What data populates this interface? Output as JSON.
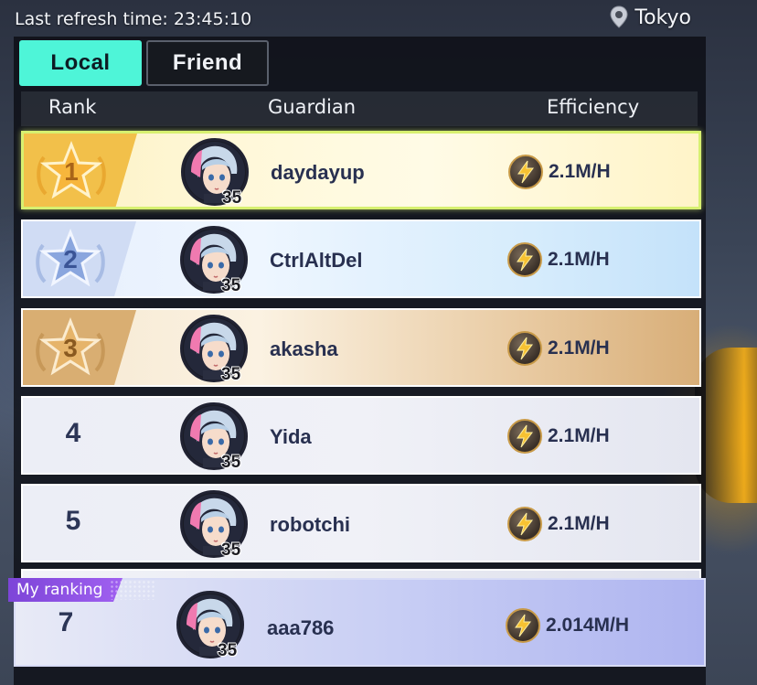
{
  "header": {
    "refresh_label": "Last refresh time: 23:45:10",
    "location": "Tokyo",
    "location_icon": "pin-icon"
  },
  "tabs": [
    {
      "label": "Local",
      "active": true
    },
    {
      "label": "Friend",
      "active": false
    }
  ],
  "columns": {
    "rank": "Rank",
    "guardian": "Guardian",
    "efficiency": "Efficiency"
  },
  "rows": [
    {
      "rank": "1",
      "name": "daydayup",
      "level": "35",
      "efficiency": "2.1M/H",
      "badge": "gold-star-badge",
      "color": "#f2c04a"
    },
    {
      "rank": "2",
      "name": "CtrlAltDel",
      "level": "35",
      "efficiency": "2.1M/H",
      "badge": "silver-star-badge",
      "color": "#8aa6de"
    },
    {
      "rank": "3",
      "name": "akasha",
      "level": "35",
      "efficiency": "2.1M/H",
      "badge": "bronze-star-badge",
      "color": "#d4a660"
    },
    {
      "rank": "4",
      "name": "Yida",
      "level": "35",
      "efficiency": "2.1M/H"
    },
    {
      "rank": "5",
      "name": "robotchi",
      "level": "35",
      "efficiency": "2.1M/H"
    }
  ],
  "my_ranking": {
    "label": "My ranking",
    "rank": "7",
    "name": "aaa786",
    "level": "35",
    "efficiency": "2.014M/H"
  },
  "colors": {
    "tab_active": "#4ef5d8",
    "my_ranking_accent": "#8a4fe6",
    "first_row_border": "#d7f070"
  }
}
